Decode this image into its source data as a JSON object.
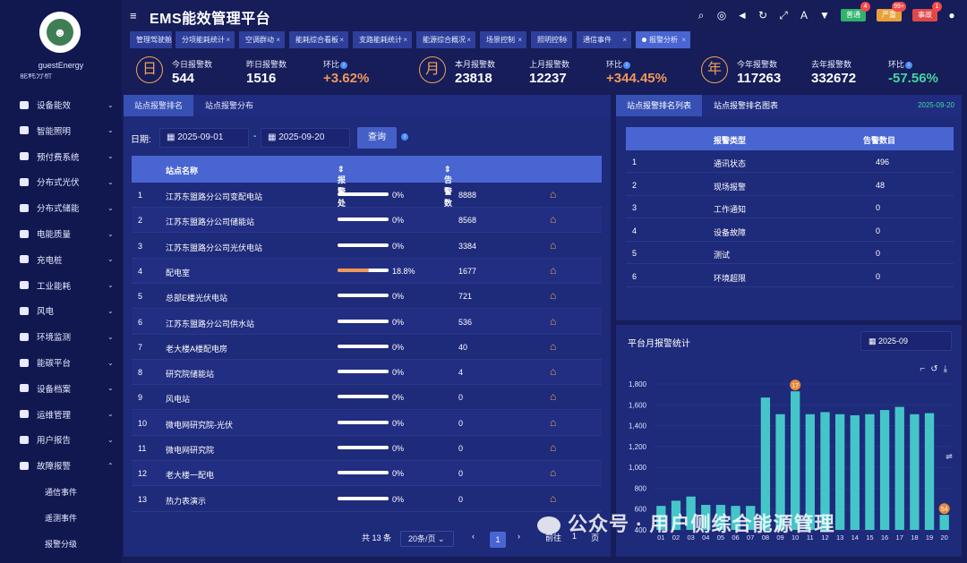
{
  "user": {
    "name": "guestEnergy"
  },
  "sidebar": {
    "cut_item": "能耗分析",
    "items": [
      {
        "label": "设备能效",
        "icon": "monitor-icon"
      },
      {
        "label": "智能照明",
        "icon": "bulb-icon"
      },
      {
        "label": "预付费系统",
        "icon": "prepay-icon"
      },
      {
        "label": "分布式光伏",
        "icon": "pv-icon"
      },
      {
        "label": "分布式储能",
        "icon": "storage-icon"
      },
      {
        "label": "电能质量",
        "icon": "power-quality-icon"
      },
      {
        "label": "充电桩",
        "icon": "charger-icon"
      },
      {
        "label": "工业能耗",
        "icon": "factory-icon"
      },
      {
        "label": "风电",
        "icon": "wind-icon"
      },
      {
        "label": "环境监测",
        "icon": "env-icon"
      },
      {
        "label": "能碳平台",
        "icon": "carbon-icon"
      },
      {
        "label": "设备档案",
        "icon": "archive-icon"
      },
      {
        "label": "运维管理",
        "icon": "maintenance-icon"
      },
      {
        "label": "用户报告",
        "icon": "report-icon"
      },
      {
        "label": "故障报警",
        "icon": "alarm-icon"
      }
    ],
    "sub_items": [
      "通信事件",
      "遥测事件",
      "报警分级"
    ]
  },
  "header": {
    "title": "EMS能效管理平台",
    "badges": [
      {
        "label": "普通",
        "count": "4",
        "color": "#2fb36a"
      },
      {
        "label": "严重",
        "count": "99+",
        "color": "#e8a13a"
      },
      {
        "label": "事故",
        "count": "1",
        "color": "#e04848"
      }
    ]
  },
  "tabs": [
    "管理驾驶舱",
    "分项能耗统计",
    "空调群动",
    "能耗综合看板",
    "支路能耗统计",
    "能源综合概况",
    "场景控制",
    "照明控制",
    "通信事件",
    "报警分析"
  ],
  "stats": [
    {
      "circle": "日",
      "cur_label": "今日报警数",
      "cur_value": "544",
      "prev_label": "昨日报警数",
      "prev_value": "1516",
      "ratio_label": "环比",
      "ratio_value": "+3.62%",
      "trend": "up"
    },
    {
      "circle": "月",
      "cur_label": "本月报警数",
      "cur_value": "23818",
      "prev_label": "上月报警数",
      "prev_value": "12237",
      "ratio_label": "环比",
      "ratio_value": "+344.45%",
      "trend": "up"
    },
    {
      "circle": "年",
      "cur_label": "今年报警数",
      "cur_value": "117263",
      "prev_label": "去年报警数",
      "prev_value": "332672",
      "ratio_label": "环比",
      "ratio_value": "-57.56%",
      "trend": "down"
    }
  ],
  "left": {
    "tabs": [
      "站点报警排名",
      "站点报警分布"
    ],
    "date_label": "日期:",
    "date_from": "2025-09-01",
    "date_to": "2025-09-20",
    "query": "查询",
    "columns": [
      "站点名称",
      "报警处理率",
      "告警数目"
    ],
    "rows": [
      {
        "no": "1",
        "name": "江苏东盟路分公司变配电站",
        "rate": "0%",
        "rate_value": 0,
        "count": "8888"
      },
      {
        "no": "2",
        "name": "江苏东盟路分公司储能站",
        "rate": "0%",
        "rate_value": 0,
        "count": "8568"
      },
      {
        "no": "3",
        "name": "江苏东盟路分公司光伏电站",
        "rate": "0%",
        "rate_value": 0,
        "count": "3384"
      },
      {
        "no": "4",
        "name": "配电室",
        "rate": "18.8%",
        "rate_value": 18.8,
        "count": "1677"
      },
      {
        "no": "5",
        "name": "总部E楼光伏电站",
        "rate": "0%",
        "rate_value": 0,
        "count": "721"
      },
      {
        "no": "6",
        "name": "江苏东盟路分公司供水站",
        "rate": "0%",
        "rate_value": 0,
        "count": "536"
      },
      {
        "no": "7",
        "name": "老大楼A楼配电房",
        "rate": "0%",
        "rate_value": 0,
        "count": "40"
      },
      {
        "no": "8",
        "name": "研究院储能站",
        "rate": "0%",
        "rate_value": 0,
        "count": "4"
      },
      {
        "no": "9",
        "name": "风电站",
        "rate": "0%",
        "rate_value": 0,
        "count": "0"
      },
      {
        "no": "10",
        "name": "微电网研究院-光伏",
        "rate": "0%",
        "rate_value": 0,
        "count": "0"
      },
      {
        "no": "11",
        "name": "微电网研究院",
        "rate": "0%",
        "rate_value": 0,
        "count": "0"
      },
      {
        "no": "12",
        "name": "老大楼一配电",
        "rate": "0%",
        "rate_value": 0,
        "count": "0"
      },
      {
        "no": "13",
        "name": "热力表演示",
        "rate": "0%",
        "rate_value": 0,
        "count": "0"
      }
    ],
    "pager": {
      "total": "共 13 条",
      "per_page": "20条/页",
      "current": "1",
      "goto": "前往",
      "page_input": "1",
      "page_unit": "页"
    }
  },
  "right_top": {
    "tabs": [
      "站点报警排名列表",
      "站点报警排名图表"
    ],
    "date": "2025-09-20",
    "columns": [
      "报警类型",
      "告警数目"
    ],
    "rows": [
      {
        "no": "1",
        "type": "通讯状态",
        "count": "496"
      },
      {
        "no": "2",
        "type": "现场报警",
        "count": "48"
      },
      {
        "no": "3",
        "type": "工作通知",
        "count": "0"
      },
      {
        "no": "4",
        "type": "设备故障",
        "count": "0"
      },
      {
        "no": "5",
        "type": "测试",
        "count": "0"
      },
      {
        "no": "6",
        "type": "环境超限",
        "count": "0"
      }
    ]
  },
  "chart_panel": {
    "title": "平台月报警统计",
    "month": "2025-09"
  },
  "chart_data": {
    "type": "bar",
    "categories": [
      "01",
      "02",
      "03",
      "04",
      "05",
      "06",
      "07",
      "08",
      "09",
      "10",
      "11",
      "12",
      "13",
      "14",
      "15",
      "16",
      "17",
      "18",
      "19",
      "20"
    ],
    "values": [
      630,
      680,
      720,
      640,
      640,
      630,
      630,
      1670,
      1510,
      1730,
      1510,
      1530,
      1510,
      1500,
      1510,
      1550,
      1580,
      1510,
      1520,
      544
    ],
    "ylim": [
      400,
      1800
    ],
    "yticks": [
      400,
      600,
      800,
      1000,
      1200,
      1400,
      1600,
      1800
    ],
    "ytick_labels": [
      "400",
      "600",
      "800",
      "1,000",
      "1,200",
      "1,400",
      "1,600",
      "1,800"
    ],
    "markers": [
      {
        "index": 9,
        "label": "17"
      },
      {
        "index": 19,
        "label": "54"
      }
    ],
    "bar_color": "#44c6c9",
    "marker_color": "#e8883a"
  },
  "watermark": "公众号 · 用户侧综合能源管理"
}
